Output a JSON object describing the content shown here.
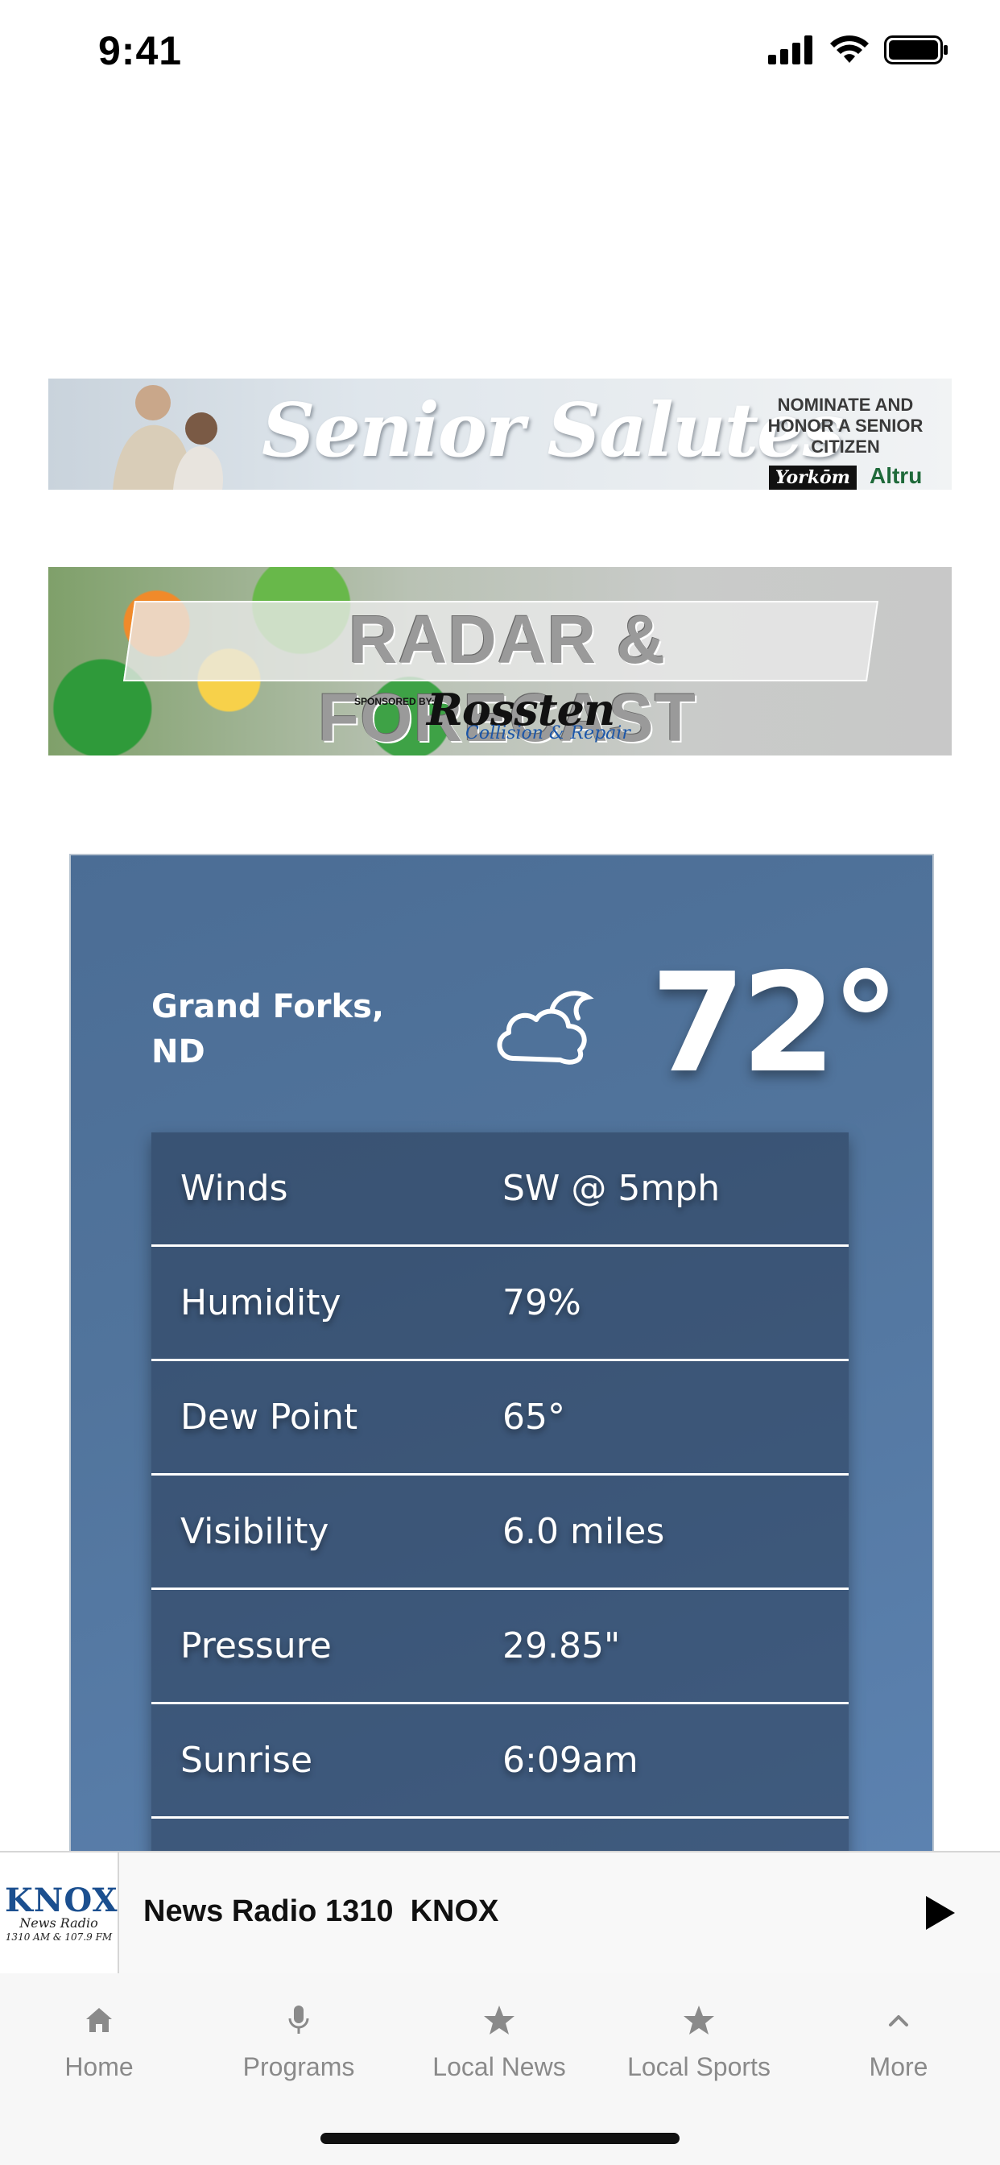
{
  "status_bar": {
    "time": "9:41"
  },
  "ads": {
    "senior_salutes": {
      "title": "Senior Salutes",
      "side_text": "NOMINATE AND HONOR A SENIOR CITIZEN",
      "sponsor_1": "Yorkōm",
      "sponsor_2": "Altru"
    },
    "radar": {
      "title": "RADAR & FORECAST",
      "sponsored_by": "SPONSORED BY:",
      "brand": "Rossten",
      "brand_sub": "Collision & Repair"
    }
  },
  "weather": {
    "location": "Grand Forks, ND",
    "temperature": "72°",
    "icon": "partly-cloudy-night-icon",
    "rows": [
      {
        "label": "Winds",
        "value": "SW @ 5mph"
      },
      {
        "label": "Humidity",
        "value": "79%"
      },
      {
        "label": "Dew Point",
        "value": "65°"
      },
      {
        "label": "Visibility",
        "value": "6.0 miles"
      },
      {
        "label": "Pressure",
        "value": "29.85\""
      },
      {
        "label": "Sunrise",
        "value": "6:09am"
      }
    ]
  },
  "player": {
    "logo_main": "KNOX",
    "logo_sub": "News Radio",
    "logo_freq": "1310 AM & 107.9 FM",
    "title": "News Radio 1310  KNOX"
  },
  "tabbar": {
    "tabs": [
      {
        "label": "Home",
        "icon": "home-icon"
      },
      {
        "label": "Programs",
        "icon": "microphone-icon"
      },
      {
        "label": "Local News",
        "icon": "star-icon"
      },
      {
        "label": "Local Sports",
        "icon": "star-icon"
      },
      {
        "label": "More",
        "icon": "chevron-up-icon"
      }
    ]
  },
  "colors": {
    "weather_bg": "#51749c",
    "tab_label": "#8a8a8a",
    "logo_blue": "#1b4f8f"
  }
}
